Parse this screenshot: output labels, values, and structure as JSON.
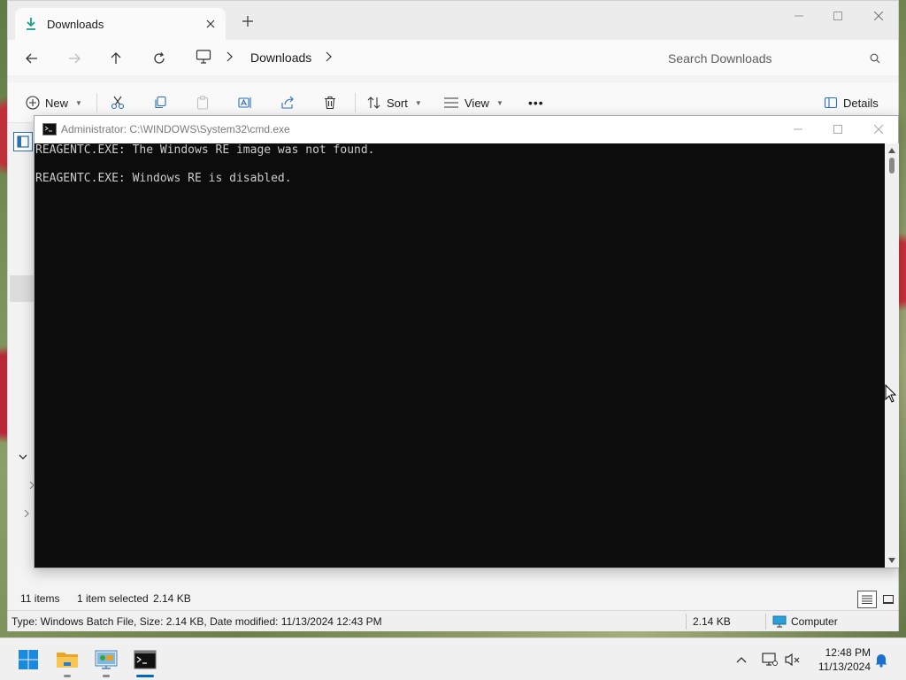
{
  "explorer": {
    "tab_title": "Downloads",
    "breadcrumb": [
      "Downloads"
    ],
    "search_placeholder": "Search Downloads",
    "toolbar": {
      "new_label": "New",
      "sort_label": "Sort",
      "view_label": "View",
      "more_label": "•••",
      "details_label": "Details"
    },
    "status": {
      "item_count": "11 items",
      "selection": "1 item selected",
      "selection_size": "2.14 KB"
    },
    "details_bar": {
      "file_info": "Type: Windows Batch File, Size: 2.14 KB, Date modified: 11/13/2024 12:43 PM",
      "size": "2.14 KB",
      "location": "Computer"
    }
  },
  "cmd": {
    "title": "Administrator: C:\\WINDOWS\\System32\\cmd.exe",
    "lines": [
      "REAGENTC.EXE: The Windows RE image was not found.",
      "REAGENTC.EXE: Windows RE is disabled."
    ]
  },
  "taskbar": {
    "time": "12:48 PM",
    "date": "11/13/2024"
  },
  "colors": {
    "accent": "#0067c0",
    "console_bg": "#0c0c0c",
    "console_fg": "#cccccc",
    "download_icon": "#1a9e8c",
    "folder": "#f2b73a"
  }
}
